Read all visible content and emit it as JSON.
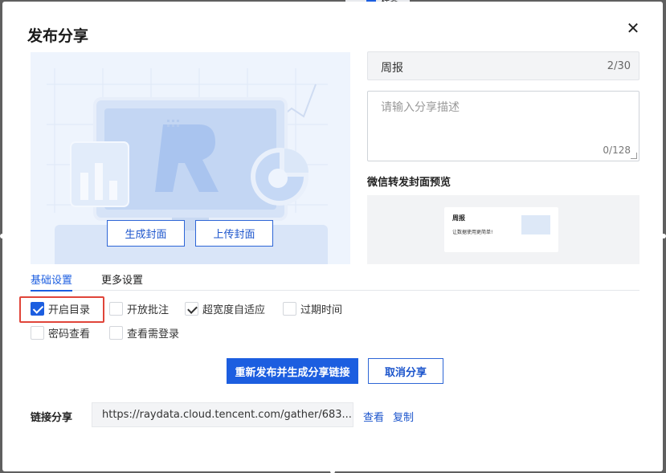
{
  "background": {
    "label": "标签"
  },
  "dialog": {
    "title": "发布分享",
    "close_icon": "close-icon"
  },
  "cover": {
    "generate_label": "生成封面",
    "upload_label": "上传封面"
  },
  "share_title": {
    "value": "周报",
    "count": "2/30"
  },
  "share_desc": {
    "placeholder": "请输入分享描述",
    "count": "0/128"
  },
  "wechat": {
    "label": "微信转发封面预览",
    "card_title": "周报",
    "card_desc": "让数据使用更简单!"
  },
  "tabs": [
    {
      "label": "基础设置",
      "active": true
    },
    {
      "label": "更多设置",
      "active": false
    }
  ],
  "options": [
    {
      "label": "开启目录",
      "checked": true
    },
    {
      "label": "开放批注",
      "checked": false
    },
    {
      "label": "超宽度自适应",
      "checked": true
    },
    {
      "label": "过期时间",
      "checked": false
    },
    {
      "label": "密码查看",
      "checked": false
    },
    {
      "label": "查看需登录",
      "checked": false
    }
  ],
  "actions": {
    "publish_label": "重新发布并生成分享链接",
    "cancel_label": "取消分享"
  },
  "link": {
    "label": "链接分享",
    "url": "https://raydata.cloud.tencent.com/gather/683...",
    "view_label": "查看",
    "copy_label": "复制"
  },
  "colors": {
    "accent": "#1c5ee0",
    "highlight": "#e0453a"
  }
}
